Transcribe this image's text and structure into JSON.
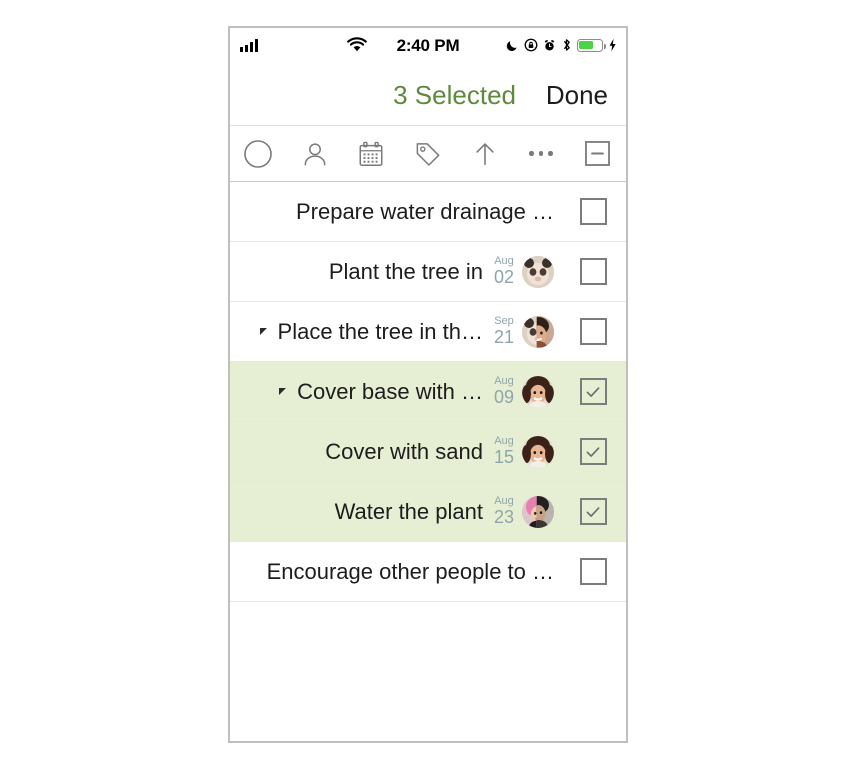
{
  "status_bar": {
    "signal_icon": "cellular-signal-icon",
    "wifi_icon": "wifi-icon",
    "time": "2:40 PM",
    "right_icons": [
      "moon-do-not-disturb-icon",
      "rotation-lock-icon",
      "alarm-clock-icon",
      "bluetooth-icon",
      "battery-icon",
      "charging-bolt-icon"
    ],
    "battery_level_percent": 62
  },
  "nav_bar": {
    "selected_label": "3 Selected",
    "selected_color": "#5e8a3e",
    "done_label": "Done",
    "done_color": "#1d1d1d"
  },
  "toolbar": {
    "items": [
      {
        "name": "circle-status-icon",
        "label": "Status"
      },
      {
        "name": "person-icon",
        "label": "Assignee"
      },
      {
        "name": "calendar-icon",
        "label": "Due date"
      },
      {
        "name": "tag-icon",
        "label": "Tag"
      },
      {
        "name": "arrow-up-icon",
        "label": "Move up"
      },
      {
        "name": "ellipsis-icon",
        "label": "More"
      },
      {
        "name": "minus-box-icon",
        "label": "Deselect all"
      }
    ]
  },
  "list": {
    "rows": [
      {
        "title": "Prepare water drainage …",
        "indent": 0,
        "has_disclosure": false,
        "date_month": "",
        "date_day": "",
        "avatars": 0,
        "checked": false,
        "selected": false
      },
      {
        "title": "Plant the tree in",
        "indent": 0,
        "has_disclosure": false,
        "date_month": "Aug",
        "date_day": "02",
        "avatars": 1,
        "checked": false,
        "selected": false
      },
      {
        "title": "Place the tree in th…",
        "indent": 1,
        "has_disclosure": true,
        "date_month": "Sep",
        "date_day": "21",
        "avatars": 2,
        "checked": false,
        "selected": false
      },
      {
        "title": "Cover base with …",
        "indent": 2,
        "has_disclosure": true,
        "date_month": "Aug",
        "date_day": "09",
        "avatars": 1,
        "checked": true,
        "selected": true
      },
      {
        "title": "Cover with sand",
        "indent": 2,
        "has_disclosure": false,
        "date_month": "Aug",
        "date_day": "15",
        "avatars": 1,
        "checked": true,
        "selected": true
      },
      {
        "title": "Water the plant",
        "indent": 2,
        "has_disclosure": false,
        "date_month": "Aug",
        "date_day": "23",
        "avatars": 2,
        "checked": true,
        "selected": true
      },
      {
        "title": "Encourage other people to …",
        "indent": 0,
        "has_disclosure": false,
        "date_month": "",
        "date_day": "",
        "avatars": 0,
        "checked": false,
        "selected": false
      }
    ],
    "selected_row_color": "#e6efd3",
    "date_color": "#8fa5ab"
  }
}
